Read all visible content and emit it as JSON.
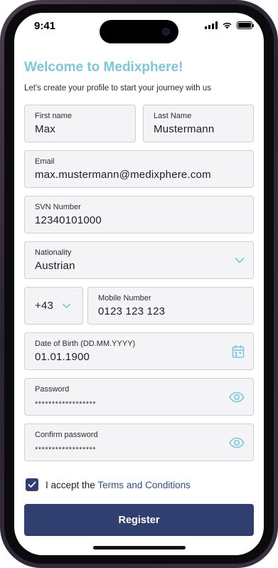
{
  "status_bar": {
    "time": "9:41"
  },
  "header": {
    "title": "Welcome to Medixphere!",
    "subtitle": "Let's create your profile to start your journey with us"
  },
  "form": {
    "first_name": {
      "label": "First name",
      "value": "Max"
    },
    "last_name": {
      "label": "Last Name",
      "value": "Mustermann"
    },
    "email": {
      "label": "Email",
      "value": "max.mustermann@medixphere.com"
    },
    "svn": {
      "label": "SVN Number",
      "value": "12340101000"
    },
    "nationality": {
      "label": "Nationality",
      "value": "Austrian"
    },
    "country_code": {
      "value": "+43"
    },
    "mobile": {
      "label": "Mobile Number",
      "value": "0123 123 123"
    },
    "dob": {
      "label": "Date of Birth (DD.MM.YYYY)",
      "value": "01.01.1900"
    },
    "password": {
      "label": "Password",
      "value": "******************"
    },
    "confirm_password": {
      "label": "Confirm password",
      "value": "******************"
    }
  },
  "terms": {
    "prefix": "I accept the",
    "link": "Terms and Conditions",
    "checked": true
  },
  "register_button": {
    "label": "Register"
  },
  "colors": {
    "accent": "#7cc7dd",
    "primary": "#2f4070",
    "link": "#2f4f86",
    "field_bg": "#f4f4f6",
    "field_border": "#cfcfd5"
  },
  "icons": {
    "dropdown": "chevron-down-icon",
    "calendar": "calendar-icon",
    "password_toggle": "eye-icon",
    "checkbox": "check-icon"
  }
}
